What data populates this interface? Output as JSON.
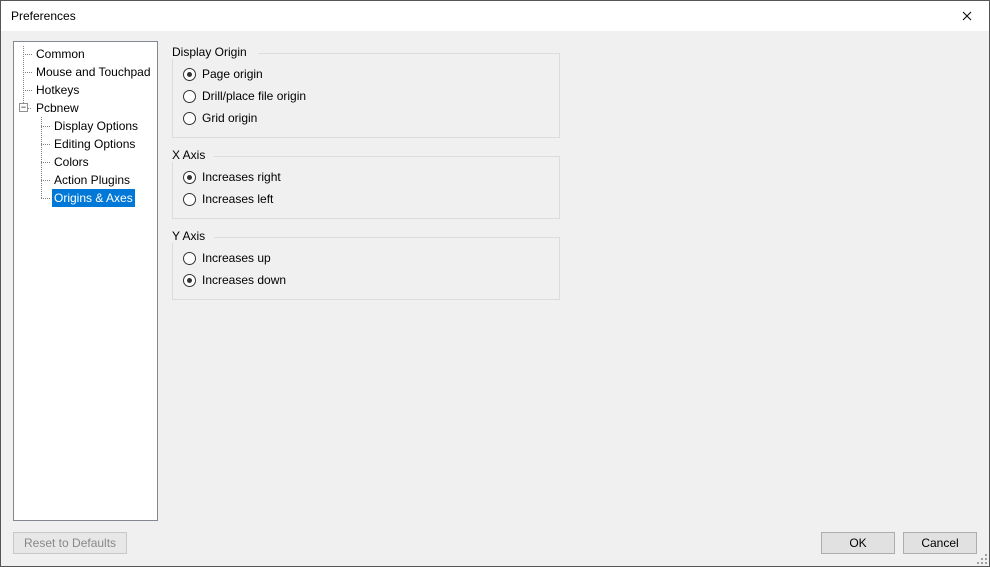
{
  "window": {
    "title": "Preferences"
  },
  "tree": {
    "items": {
      "common": "Common",
      "mouse": "Mouse and Touchpad",
      "hotkeys": "Hotkeys",
      "pcbnew": "Pcbnew",
      "display_options": "Display Options",
      "editing_options": "Editing Options",
      "colors": "Colors",
      "action_plugins": "Action Plugins",
      "origins_axes": "Origins & Axes"
    },
    "selected": "origins_axes",
    "expander_glyph": "−"
  },
  "groups": {
    "display_origin": {
      "legend": "Display Origin",
      "options": {
        "page": {
          "label": "Page origin",
          "checked": true
        },
        "drill": {
          "label": "Drill/place file origin",
          "checked": false
        },
        "grid": {
          "label": "Grid origin",
          "checked": false
        }
      }
    },
    "x_axis": {
      "legend": "X Axis",
      "options": {
        "right": {
          "label": "Increases right",
          "checked": true
        },
        "left": {
          "label": "Increases left",
          "checked": false
        }
      }
    },
    "y_axis": {
      "legend": "Y Axis",
      "options": {
        "up": {
          "label": "Increases up",
          "checked": false
        },
        "down": {
          "label": "Increases down",
          "checked": true
        }
      }
    }
  },
  "buttons": {
    "reset": "Reset to Defaults",
    "ok": "OK",
    "cancel": "Cancel"
  }
}
